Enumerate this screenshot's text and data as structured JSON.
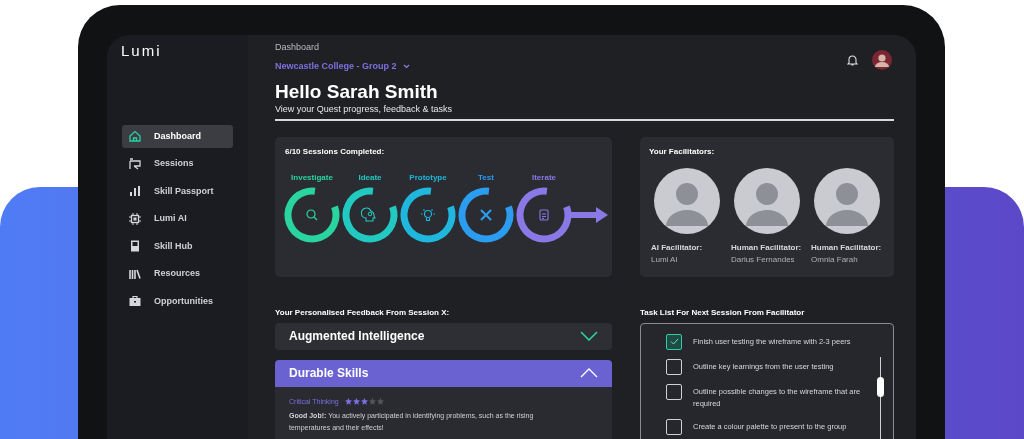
{
  "sidebar": {
    "logo": "Lumi",
    "items": [
      {
        "label": "Dashboard",
        "selected": true
      },
      {
        "label": "Sessions",
        "selected": false
      },
      {
        "label": "Skill Passport",
        "selected": false
      },
      {
        "label": "Lumi AI",
        "selected": false
      },
      {
        "label": "Skill Hub",
        "selected": false
      },
      {
        "label": "Resources",
        "selected": false
      },
      {
        "label": "Opportunities",
        "selected": false
      }
    ]
  },
  "header": {
    "breadcrumb": "Dashboard",
    "group": "Newcastle College - Group 2",
    "title": "Hello Sarah Smith",
    "subtitle": "View your Quest progress, feedback & tasks"
  },
  "progress": {
    "title": "6/10 Sessions Completed:",
    "stages": [
      {
        "label": "Investigate",
        "color": "#2ad4a0"
      },
      {
        "label": "Ideate",
        "color": "#22c9c0"
      },
      {
        "label": "Prototype",
        "color": "#1fb7dd"
      },
      {
        "label": "Test",
        "color": "#2b9cf0"
      },
      {
        "label": "Iterate",
        "color": "#8a78e6"
      }
    ]
  },
  "facilitators": {
    "title": "Your Facilitators:",
    "people": [
      {
        "role": "AI Facilitator:",
        "name": "Lumi AI"
      },
      {
        "role": "Human Facilitator:",
        "name": "Darius Fernandes"
      },
      {
        "role": "Human Facilitator:",
        "name": "Omnia Farah"
      }
    ]
  },
  "feedback": {
    "title": "Your Personalised Feedback From Session X:",
    "sections": [
      {
        "title": "Augmented Intelligence",
        "expanded": false
      },
      {
        "title": "Durable Skills",
        "expanded": true,
        "skill": "Critical Thinking",
        "stars": 3,
        "text": "**Good Job!:** You actively participated in identifying problems, such as the rising temperatures and their effects!"
      }
    ]
  },
  "tasks": {
    "title": "Task List For Next Session From Facilitator",
    "items": [
      {
        "label": "Finish user testing the wireframe with 2-3 peers",
        "checked": true
      },
      {
        "label": "Outline key learnings from the user testing",
        "checked": false
      },
      {
        "label": "Outline possible changes to the wireframe that are required",
        "checked": false
      },
      {
        "label": "Create a colour palette to present to the group",
        "checked": false
      }
    ]
  }
}
